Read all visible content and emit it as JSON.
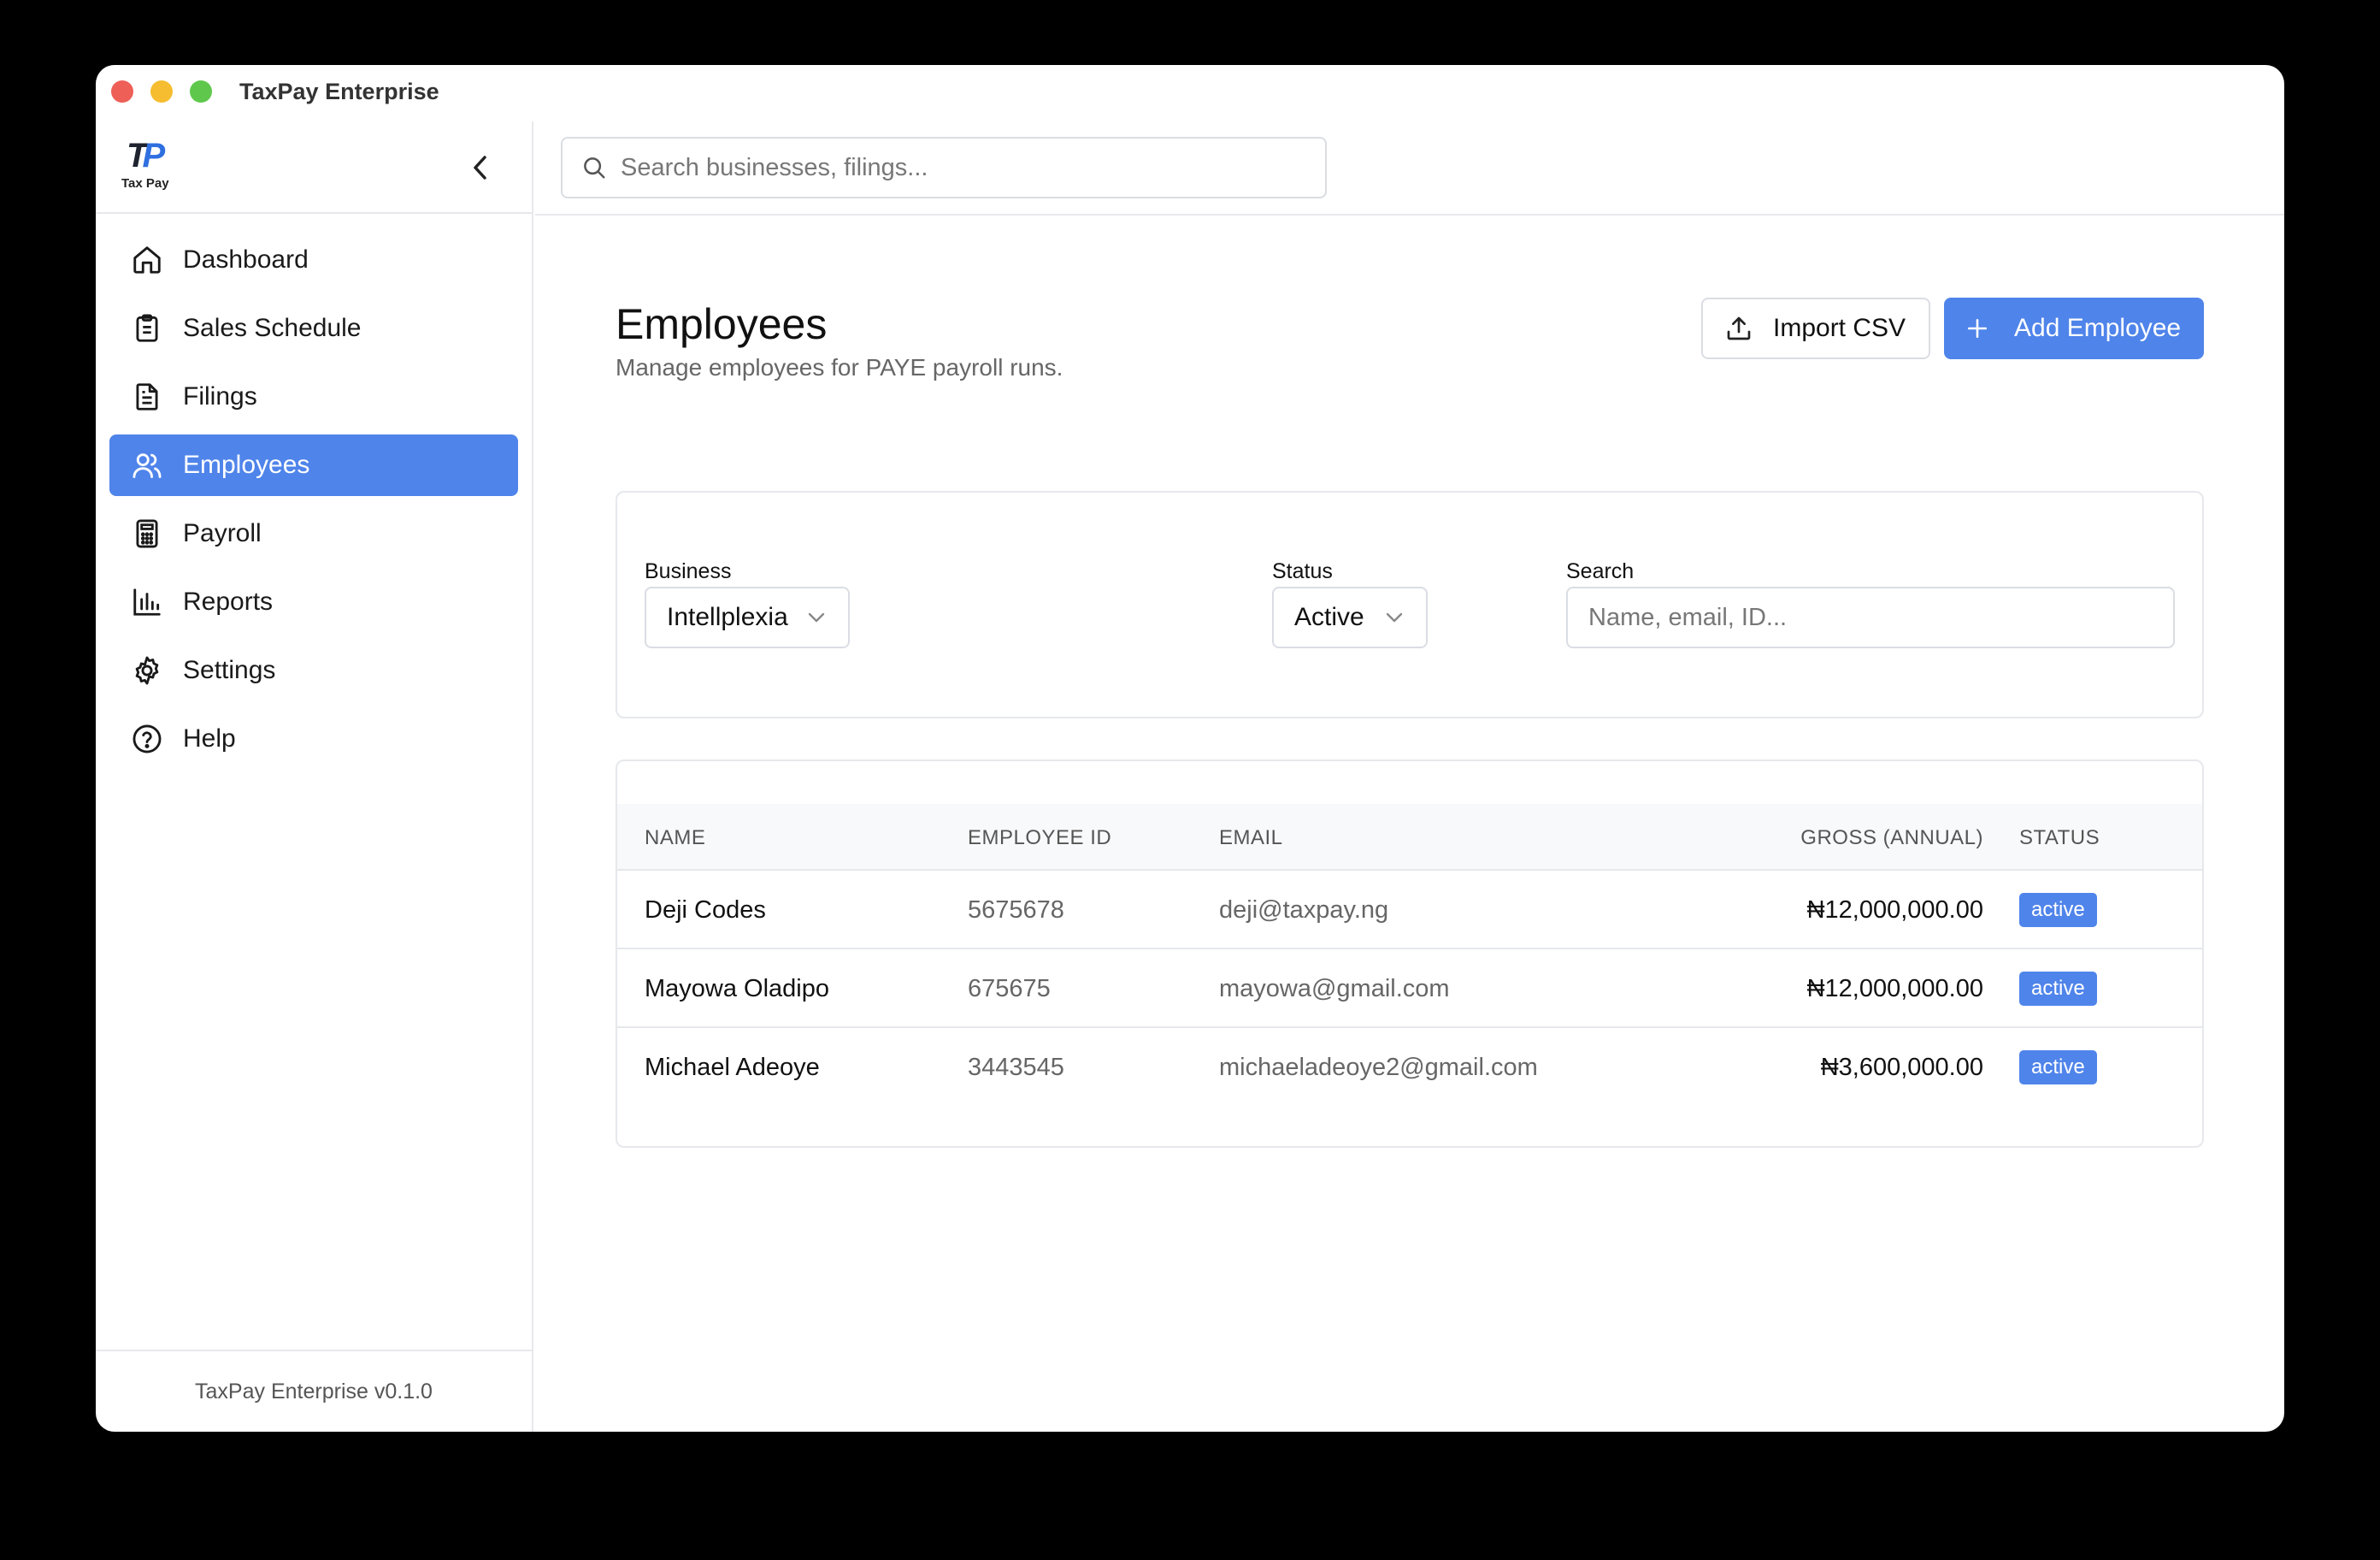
{
  "window": {
    "title": "TaxPay Enterprise"
  },
  "sidebar": {
    "logo_text": "Tax Pay",
    "items": [
      {
        "label": "Dashboard",
        "icon": "home-icon"
      },
      {
        "label": "Sales Schedule",
        "icon": "clipboard-icon"
      },
      {
        "label": "Filings",
        "icon": "document-icon"
      },
      {
        "label": "Employees",
        "icon": "users-icon",
        "active": true
      },
      {
        "label": "Payroll",
        "icon": "calculator-icon"
      },
      {
        "label": "Reports",
        "icon": "bar-chart-icon"
      },
      {
        "label": "Settings",
        "icon": "gear-icon"
      },
      {
        "label": "Help",
        "icon": "help-circle-icon"
      }
    ],
    "footer": "TaxPay Enterprise v0.1.0"
  },
  "topbar": {
    "search_placeholder": "Search businesses, filings..."
  },
  "main": {
    "title": "Employees",
    "subtitle": "Manage employees for PAYE payroll runs.",
    "import_label": "Import CSV",
    "add_label": "Add Employee"
  },
  "filters": {
    "business_label": "Business",
    "business_value": "Intellplexia",
    "status_label": "Status",
    "status_value": "Active",
    "search_label": "Search",
    "search_placeholder": "Name, email, ID..."
  },
  "table": {
    "headers": [
      "NAME",
      "EMPLOYEE ID",
      "EMAIL",
      "GROSS (ANNUAL)",
      "STATUS"
    ],
    "rows": [
      {
        "name": "Deji Codes",
        "id": "5675678",
        "email": "deji@taxpay.ng",
        "gross": "₦12,000,000.00",
        "status": "active"
      },
      {
        "name": "Mayowa Oladipo",
        "id": "675675",
        "email": "mayowa@gmail.com",
        "gross": "₦12,000,000.00",
        "status": "active"
      },
      {
        "name": "Michael Adeoye",
        "id": "3443545",
        "email": "michaeladeoye2@gmail.com",
        "gross": "₦3,600,000.00",
        "status": "active"
      }
    ]
  },
  "colors": {
    "accent": "#4f84ea",
    "border": "#e6e8ec"
  }
}
